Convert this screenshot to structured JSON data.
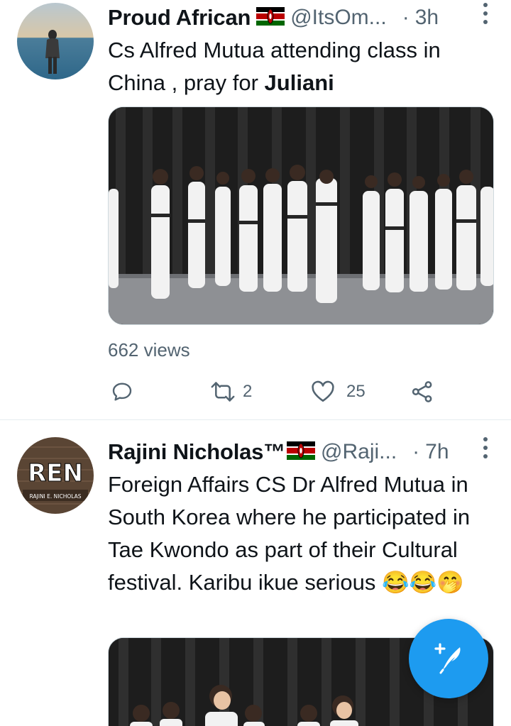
{
  "tweets": [
    {
      "display_name": "Proud African",
      "handle": "@ItsOm...",
      "separator": "·",
      "time": "3h",
      "text_plain": "Cs Alfred Mutua attending class in China , pray for ",
      "text_bold": "Juliani",
      "views": "662 views",
      "retweets": "2",
      "likes": "25",
      "avatar_icon": "person-at-sea-avatar",
      "flag_icon": "kenya-flag-icon"
    },
    {
      "display_name": "Rajini Nicholas™",
      "handle": "@Raji...",
      "separator": "·",
      "time": "7h",
      "text_plain": "Foreign Affairs CS Dr Alfred Mutua in South Korea where he participated in Tae Kwondo as part of their Cultural festival. Karibu ikue serious 😂😂🤭",
      "avatar_text": "REN",
      "avatar_subtext": "RAJINI E. NICHOLAS",
      "flag_icon": "kenya-flag-icon"
    }
  ],
  "colors": {
    "accent": "#1d9bf0",
    "text": "#0f1419",
    "muted": "#536471",
    "divider": "#e6ecf0"
  },
  "compose_button": {
    "icon": "compose-feather-plus-icon"
  }
}
